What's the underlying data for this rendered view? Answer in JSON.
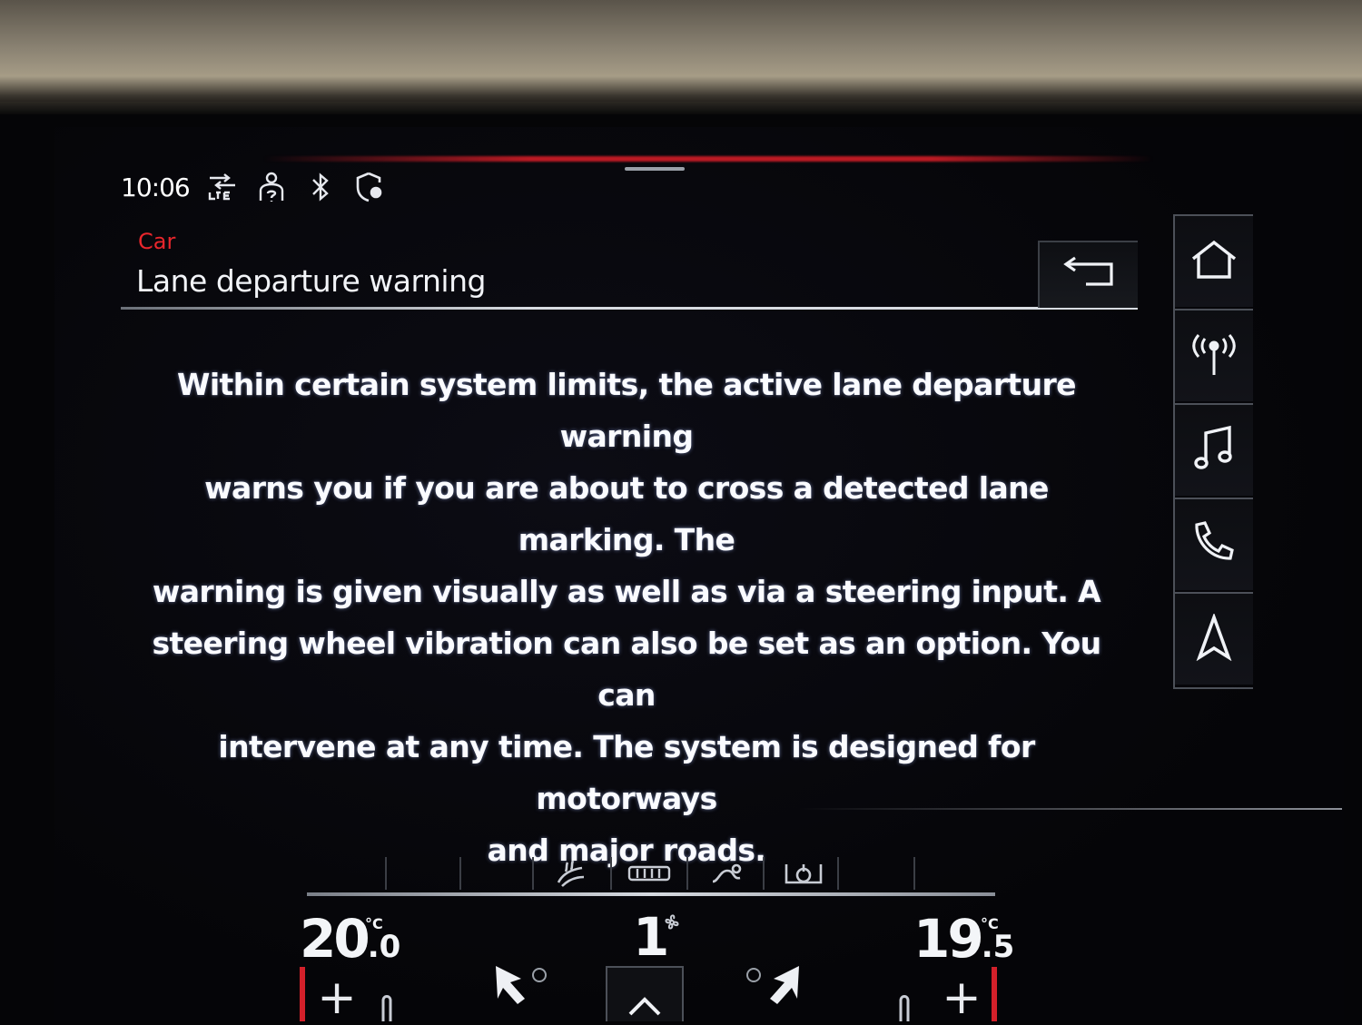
{
  "status_bar": {
    "time": "10:06",
    "icons": [
      "lte-signal-icon",
      "driver-profile-icon",
      "bluetooth-icon",
      "privacy-shield-icon"
    ]
  },
  "header": {
    "breadcrumb": "Car",
    "title": "Lane departure warning",
    "back_icon": "back-arrow-icon"
  },
  "content": {
    "lines": [
      "Within certain system limits, the active lane departure warning",
      "warns you if you are about to cross a detected lane marking. The",
      "warning is given visually as well as via a steering input. A",
      "steering wheel vibration can also be set as an option. You can",
      "intervene at any time. The system is designed for motorways",
      "and major roads."
    ]
  },
  "shortcuts": [
    {
      "name": "home",
      "icon": "home-icon"
    },
    {
      "name": "radio",
      "icon": "radio-antenna-icon"
    },
    {
      "name": "media",
      "icon": "music-note-icon"
    },
    {
      "name": "phone",
      "icon": "phone-icon"
    },
    {
      "name": "navigation",
      "icon": "navigation-arrow-icon"
    }
  ],
  "climate": {
    "left_temp_whole": "20",
    "left_temp_decimal": ".0",
    "right_temp_whole": "19",
    "right_temp_decimal": ".5",
    "unit": "°C",
    "fan_level": "1",
    "top_icons": [
      "seat-heat-icon",
      "rear-defrost-icon",
      "airflow-mode-icon",
      "steering-heat-icon"
    ],
    "plus_label": "+",
    "accent_color": "#d3202a"
  }
}
